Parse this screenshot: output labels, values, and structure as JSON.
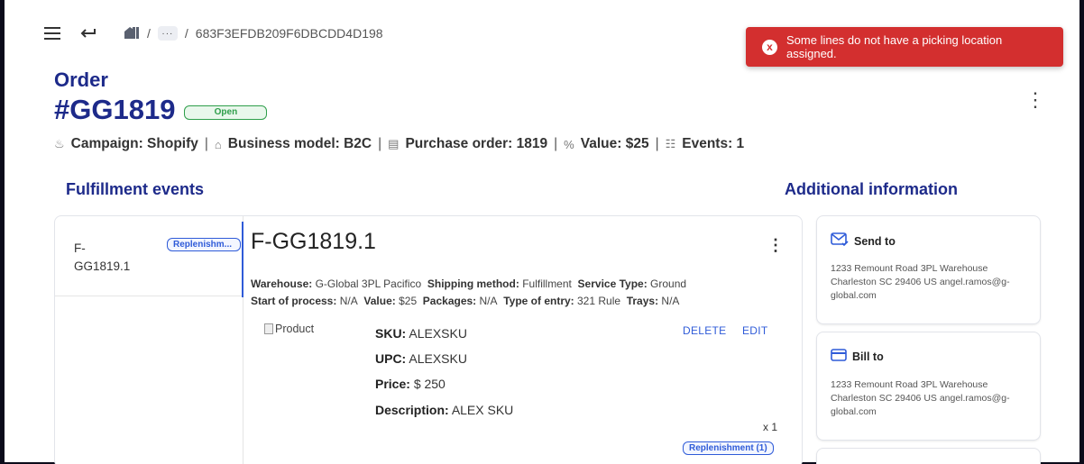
{
  "header": {
    "menu_icon": "hamburger-icon",
    "back_icon": "back-arrow-icon",
    "home_icon": "home-icon",
    "breadcrumb_sep1": "/",
    "breadcrumb_ellipsis": "···",
    "breadcrumb_sep2": "/",
    "breadcrumb_current": "683F3EFDB209F6DBCDD4D198"
  },
  "toast": {
    "message": "Some lines do not have a picking location assigned.",
    "icon": "x",
    "color": "#d32f2f"
  },
  "order": {
    "label": "Order",
    "number": "#GG1819",
    "status": "Open",
    "meta": {
      "campaign": "Campaign: Shopify",
      "business_model": "Business model: B2C",
      "purchase_order": "Purchase order: 1819",
      "value": "Value: $25",
      "events": "Events: 1",
      "separator": "|"
    }
  },
  "fulfillment": {
    "section_title": "Fulfillment events",
    "event_list": [
      {
        "label": "F-GG1819.1",
        "chip": "Replenishm..."
      }
    ],
    "detail": {
      "title": "F-GG1819.1",
      "warehouse_label": "Warehouse:",
      "warehouse": "G-Global 3PL Pacifico",
      "shipping_label": "Shipping method:",
      "shipping": "Fulfillment",
      "service_label": "Service Type:",
      "service": "Ground",
      "start_label": "Start of process:",
      "start": "N/A",
      "value_label": "Value:",
      "value": "$25",
      "packages_label": "Packages:",
      "packages": "N/A",
      "entry_label": "Type of entry:",
      "entry": "321 Rule",
      "trays_label": "Trays:",
      "trays": "N/A"
    },
    "product": {
      "image_alt": "Product",
      "sku_label": "SKU:",
      "sku": "ALEXSKU",
      "upc_label": "UPC:",
      "upc": "ALEXSKU",
      "price_label": "Price:",
      "price": "$ 250",
      "desc_label": "Description:",
      "desc": "ALEX SKU",
      "delete": "DELETE",
      "edit": "EDIT",
      "qty": "x 1",
      "chip": "Replenishment (1)"
    }
  },
  "additional": {
    "section_title": "Additional information",
    "send_to": {
      "title": "Send to",
      "icon": "envelope-check-icon",
      "address": "1233 Remount Road 3PL Warehouse Charleston SC 29406 US angel.ramos@g-global.com"
    },
    "bill_to": {
      "title": "Bill to",
      "icon": "credit-card-icon",
      "address": "1233 Remount Road 3PL Warehouse Charleston SC 29406 US angel.ramos@g-global.com"
    }
  },
  "colors": {
    "brand": "#1d2a8a",
    "accent": "#2f5bd8",
    "open_green": "#2e9e4a",
    "error": "#d32f2f"
  }
}
